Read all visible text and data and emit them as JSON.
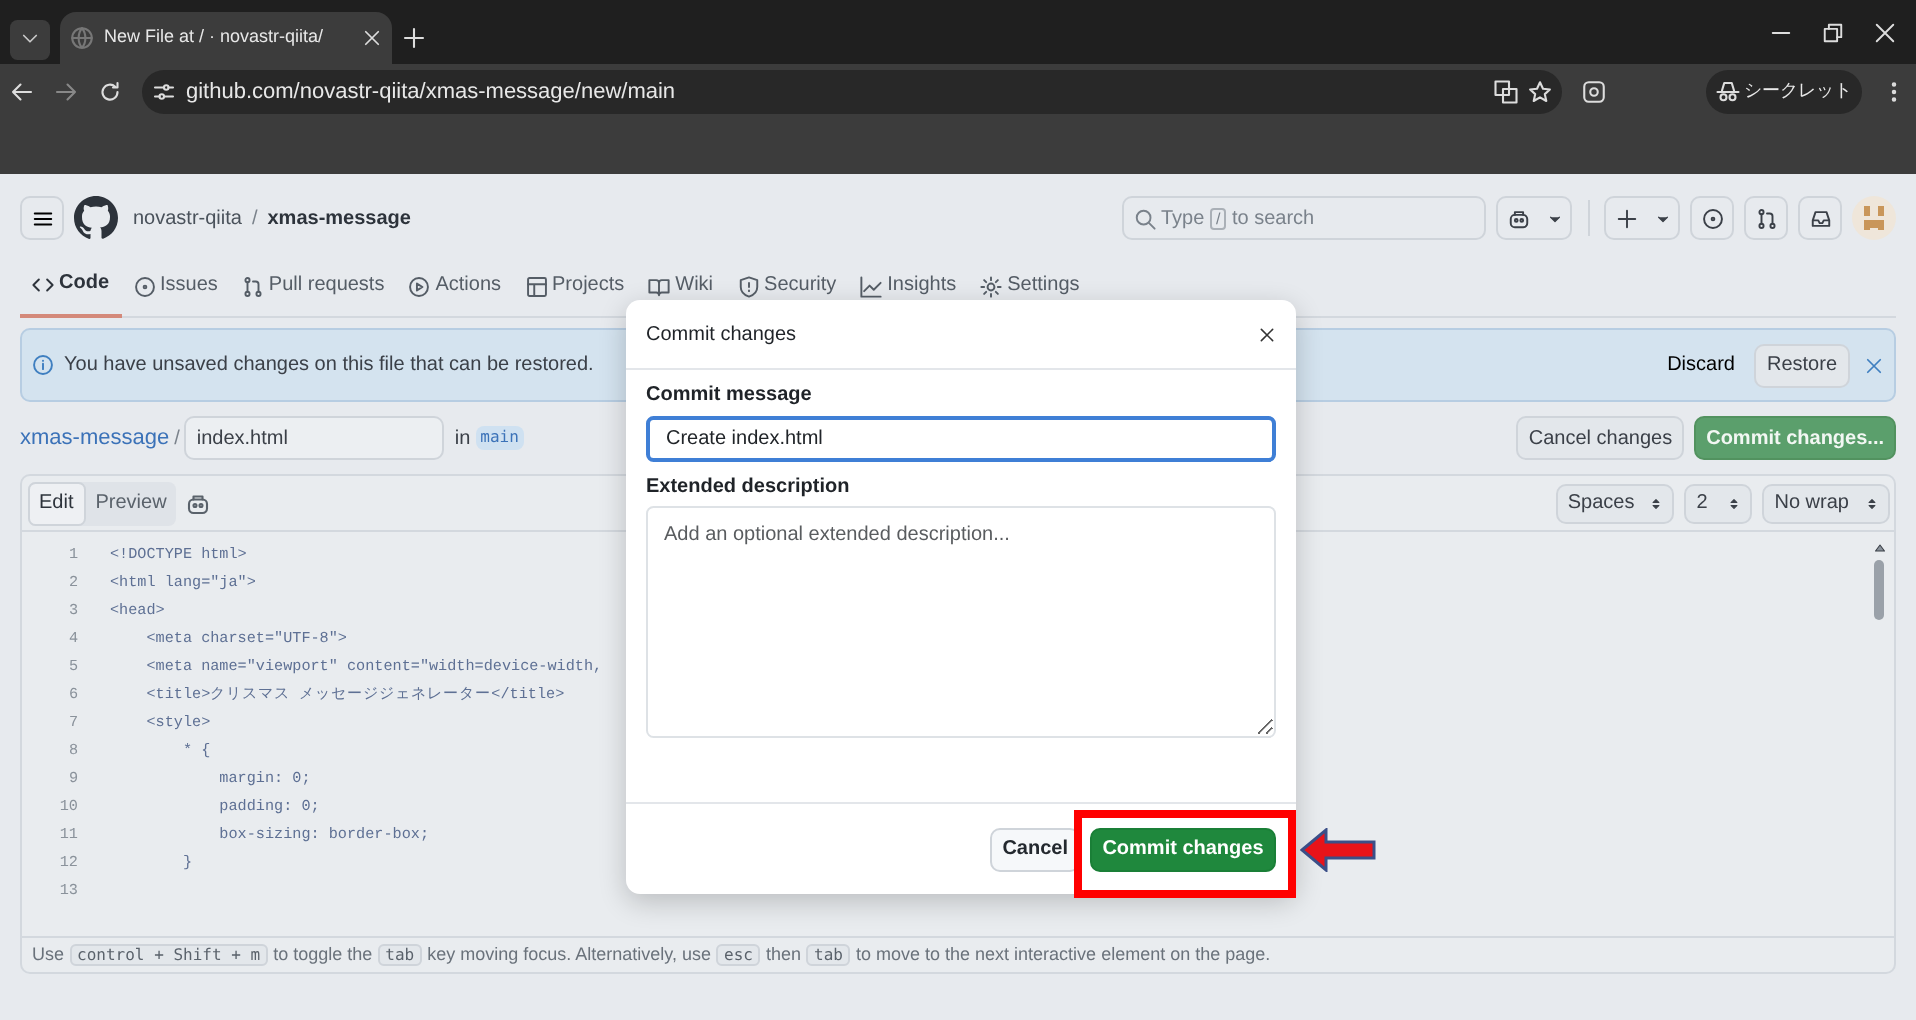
{
  "browser": {
    "tab_title": "New File at / · novastr-qiita/",
    "url": "github.com/novastr-qiita/xmas-message/new/main",
    "incognito_label": "シークレット"
  },
  "header": {
    "owner": "novastr-qiita",
    "separator": "/",
    "repo": "xmas-message",
    "search": {
      "before": "Type",
      "key": "/",
      "after": "to search"
    }
  },
  "nav_tabs": [
    {
      "label": "Code",
      "selected": true
    },
    {
      "label": "Issues",
      "selected": false
    },
    {
      "label": "Pull requests",
      "selected": false
    },
    {
      "label": "Actions",
      "selected": false
    },
    {
      "label": "Projects",
      "selected": false
    },
    {
      "label": "Wiki",
      "selected": false
    },
    {
      "label": "Security",
      "selected": false
    },
    {
      "label": "Insights",
      "selected": false
    },
    {
      "label": "Settings",
      "selected": false
    }
  ],
  "banner": {
    "message": "You have unsaved changes on this file that can be restored.",
    "discard": "Discard",
    "restore": "Restore"
  },
  "file_bar": {
    "repo_link": "xmas-message",
    "separator": "/",
    "filename": "index.html",
    "in_label": "in",
    "branch": "main",
    "cancel": "Cancel changes",
    "commit": "Commit changes..."
  },
  "editor": {
    "mode_tabs": [
      {
        "label": "Edit",
        "selected": true
      },
      {
        "label": "Preview",
        "selected": false
      }
    ],
    "selects": [
      "Spaces",
      "2",
      "No wrap"
    ],
    "lines": [
      {
        "number": "1",
        "code": "<!DOCTYPE html>"
      },
      {
        "number": "2",
        "code": "<html lang=\"ja\">"
      },
      {
        "number": "3",
        "code": "<head>"
      },
      {
        "number": "4",
        "code": "    <meta charset=\"UTF-8\">"
      },
      {
        "number": "5",
        "code": "    <meta name=\"viewport\" content=\"width=device-width,"
      },
      {
        "number": "6",
        "code": "    <title>クリスマス メッセージジェネレーター</title>"
      },
      {
        "number": "7",
        "code": "    <style>"
      },
      {
        "number": "8",
        "code": "        * {"
      },
      {
        "number": "9",
        "code": "            margin: 0;"
      },
      {
        "number": "10",
        "code": "            padding: 0;"
      },
      {
        "number": "11",
        "code": "            box-sizing: border-box;"
      },
      {
        "number": "12",
        "code": "        }"
      },
      {
        "number": "13"
      }
    ],
    "footer": [
      {
        "kind": "text",
        "text": "Use"
      },
      {
        "kind": "key",
        "text": "control + Shift + m"
      },
      {
        "kind": "text",
        "text": "to toggle the"
      },
      {
        "kind": "key",
        "text": "tab"
      },
      {
        "kind": "text",
        "text": "key moving focus. Alternatively, use"
      },
      {
        "kind": "key",
        "text": "esc"
      },
      {
        "kind": "text",
        "text": "then"
      },
      {
        "kind": "key",
        "text": "tab"
      },
      {
        "kind": "text",
        "text": "to move to the next interactive element on the page."
      }
    ]
  },
  "dialog": {
    "title": "Commit changes",
    "message_label": "Commit message",
    "message_value": "Create index.html",
    "description_label": "Extended description",
    "description_placeholder": "Add an optional extended description...",
    "cancel": "Cancel",
    "commit": "Commit changes"
  }
}
